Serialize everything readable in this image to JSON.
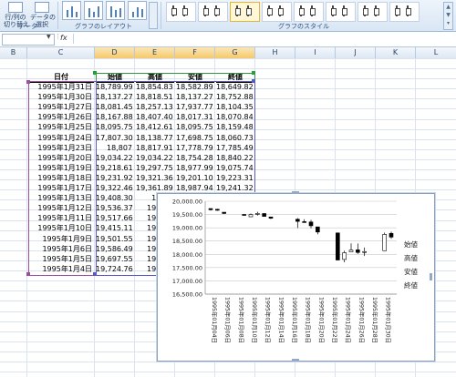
{
  "ribbon": {
    "buttons": [
      {
        "label": "行/列の\n切り替え"
      },
      {
        "label": "データの\n選択"
      }
    ],
    "groups": {
      "data": "データ",
      "layout": "グラフのレイアウト",
      "style": "グラフのスタイル"
    }
  },
  "formula_bar": {
    "fx": "fx",
    "value": ""
  },
  "columns": [
    "B",
    "C",
    "D",
    "E",
    "F",
    "G",
    "H",
    "I",
    "J",
    "K",
    "L"
  ],
  "table": {
    "headers": [
      "日付",
      "始値",
      "高値",
      "安値",
      "終値"
    ],
    "rows": [
      [
        "1995年1月31日",
        "18,789.99",
        "18,854.83",
        "18,582.89",
        "18,649.82"
      ],
      [
        "1995年1月30日",
        "18,137.27",
        "18,818.51",
        "18,137.27",
        "18,752.88"
      ],
      [
        "1995年1月27日",
        "18,081.45",
        "18,257.13",
        "17,937.77",
        "18,104.35"
      ],
      [
        "1995年1月26日",
        "18,167.88",
        "18,407.40",
        "18,017.31",
        "18,070.84"
      ],
      [
        "1995年1月25日",
        "18,095.75",
        "18,412.61",
        "18,095.75",
        "18,159.48"
      ],
      [
        "1995年1月24日",
        "17,807.30",
        "18,138.77",
        "17,698.75",
        "18,060.73"
      ],
      [
        "1995年1月23日",
        "18,807",
        "18,817.91",
        "17,778.79",
        "17,785.49"
      ],
      [
        "1995年1月20日",
        "19,034.22",
        "19,034.22",
        "18,754.28",
        "18,840.22"
      ],
      [
        "1995年1月19日",
        "19,218.61",
        "19,297.75",
        "18,977.99",
        "19,075.74"
      ],
      [
        "1995年1月18日",
        "19,231.92",
        "19,321.36",
        "19,201.10",
        "19,223.31"
      ],
      [
        "1995年1月17日",
        "19,322.46",
        "19,361.89",
        "18,987.94",
        "19,241.32"
      ],
      [
        "1995年1月13日",
        "19,408.30",
        "19,40",
        "",
        ""
      ],
      [
        "1995年1月12日",
        "19,536.37",
        "19,546",
        "",
        ""
      ],
      [
        "1995年1月11日",
        "19,517.66",
        "19,603",
        "",
        ""
      ],
      [
        "1995年1月10日",
        "19,415.11",
        "19,543",
        "",
        ""
      ],
      [
        "1995年1月9日",
        "19,501.55",
        "19,523",
        "",
        ""
      ],
      [
        "1995年1月6日",
        "19,586.49",
        "19,589",
        "",
        ""
      ],
      [
        "1995年1月5日",
        "19,697.55",
        "19,717",
        "",
        ""
      ],
      [
        "1995年1月4日",
        "19,724.76",
        "19,724",
        "",
        ""
      ]
    ]
  },
  "chart_data": {
    "type": "candlestick",
    "ylim": [
      16500,
      20000
    ],
    "y_ticks": [
      "20,000.00",
      "19,500.00",
      "19,000.00",
      "18,500.00",
      "18,000.00",
      "17,500.00",
      "17,000.00",
      "16,500.00"
    ],
    "x_tick_labels": [
      "1995年01月04日",
      "1995年01月06日",
      "1995年01月08日",
      "1995年01月10日",
      "1995年01月12日",
      "1995年01月14日",
      "1995年01月16日",
      "1995年01月18日",
      "1995年01月20日",
      "1995年01月22日",
      "1995年01月24日",
      "1995年01月26日",
      "1995年01月28日",
      "1995年01月30日"
    ],
    "legend": [
      "始値",
      "高値",
      "安値",
      "終値"
    ],
    "legend_position": "right",
    "series": [
      {
        "date": "1995-01-04",
        "open": 19724.76,
        "high": 19724,
        "low": 19650,
        "close": 19680
      },
      {
        "date": "1995-01-05",
        "open": 19697.55,
        "high": 19717,
        "low": 19640,
        "close": 19660
      },
      {
        "date": "1995-01-06",
        "open": 19586.49,
        "high": 19589,
        "low": 19520,
        "close": 19540
      },
      {
        "date": "1995-01-09",
        "open": 19501.55,
        "high": 19523,
        "low": 19480,
        "close": 19500
      },
      {
        "date": "1995-01-10",
        "open": 19415.11,
        "high": 19543,
        "low": 19410,
        "close": 19500
      },
      {
        "date": "1995-01-11",
        "open": 19517.66,
        "high": 19603,
        "low": 19460,
        "close": 19540
      },
      {
        "date": "1995-01-12",
        "open": 19536.37,
        "high": 19546,
        "low": 19420,
        "close": 19430
      },
      {
        "date": "1995-01-13",
        "open": 19408.3,
        "high": 19400,
        "low": 19330,
        "close": 19360
      },
      {
        "date": "1995-01-17",
        "open": 19322.46,
        "high": 19361.89,
        "low": 18987.94,
        "close": 19241.32
      },
      {
        "date": "1995-01-18",
        "open": 19231.92,
        "high": 19321.36,
        "low": 19201.1,
        "close": 19223.31
      },
      {
        "date": "1995-01-19",
        "open": 19218.61,
        "high": 19297.75,
        "low": 18977.99,
        "close": 19075.74
      },
      {
        "date": "1995-01-20",
        "open": 19034.22,
        "high": 19034.22,
        "low": 18754.28,
        "close": 18840.22
      },
      {
        "date": "1995-01-23",
        "open": 18807,
        "high": 18817.91,
        "low": 17778.79,
        "close": 17785.49
      },
      {
        "date": "1995-01-24",
        "open": 17807.3,
        "high": 18138.77,
        "low": 17698.75,
        "close": 18060.73
      },
      {
        "date": "1995-01-25",
        "open": 18095.75,
        "high": 18412.61,
        "low": 18095.75,
        "close": 18159.48
      },
      {
        "date": "1995-01-26",
        "open": 18167.88,
        "high": 18407.4,
        "low": 18017.31,
        "close": 18070.84
      },
      {
        "date": "1995-01-27",
        "open": 18081.45,
        "high": 18257.13,
        "low": 17937.77,
        "close": 18104.35
      },
      {
        "date": "1995-01-30",
        "open": 18137.27,
        "high": 18818.51,
        "low": 18137.27,
        "close": 18752.88
      },
      {
        "date": "1995-01-31",
        "open": 18789.99,
        "high": 18854.83,
        "low": 18582.89,
        "close": 18649.82
      }
    ],
    "colors": {
      "up": "#ffffff",
      "down": "#000000",
      "line": "#000000"
    }
  }
}
